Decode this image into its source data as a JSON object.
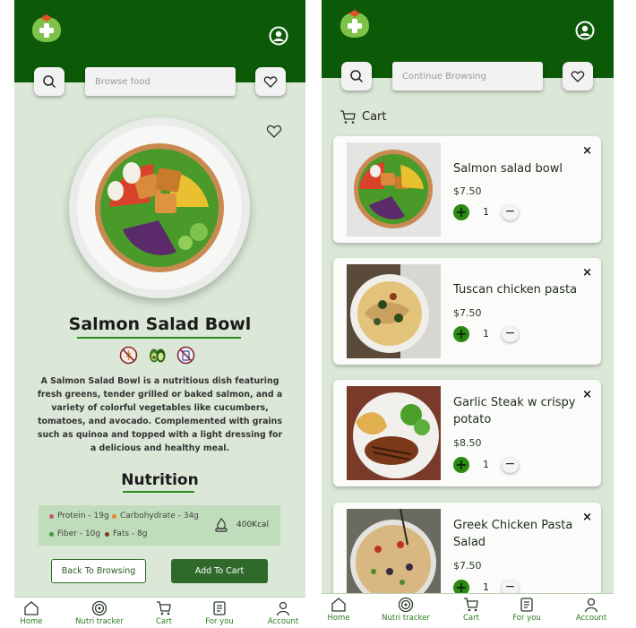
{
  "detail": {
    "search_placeholder": "Browse food",
    "title": "Salmon Salad Bowl",
    "description": "A Salmon Salad Bowl is a nutritious dish featuring fresh greens, tender grilled or baked salmon, and a variety of colorful vegetables like cucumbers, tomatoes, and avocado. Complemented with grains such as quinoa and topped with a light dressing for a delicious and healthy meal.",
    "diet_icons": [
      "no-gluten-icon",
      "avocado-icon",
      "no-dairy-icon"
    ],
    "nutrition_heading": "Nutrition",
    "nutrients": [
      {
        "label": "Protein - 19g",
        "color": "#c0567a"
      },
      {
        "label": "Carbohydrate - 34g",
        "color": "#e08a2a"
      },
      {
        "label": "Fiber - 10g",
        "color": "#3f9a3a"
      },
      {
        "label": "Fats - 8g",
        "color": "#7a3b1a"
      }
    ],
    "calories": "400Kcal",
    "back_button": "Back To Browsing",
    "add_button": "Add To Cart"
  },
  "cart_screen": {
    "search_placeholder": "Continue Browsing",
    "heading": "Cart",
    "items": [
      {
        "name": "Salmon salad bowl",
        "price": "$7.50",
        "qty": "1"
      },
      {
        "name": "Tuscan chicken pasta",
        "price": "$7.50",
        "qty": "1"
      },
      {
        "name": "Garlic Steak w crispy potato",
        "price": "$8.50",
        "qty": "1"
      },
      {
        "name": "Greek Chicken Pasta Salad",
        "price": "$7.50",
        "qty": "1"
      }
    ]
  },
  "nav": [
    "Home",
    "Nutri tracker",
    "Cart",
    "For you",
    "Account"
  ],
  "colors": {
    "header_green": "#0c5a07",
    "background": "#dbe8d8",
    "accent_green": "#2a8a12",
    "button_green": "#2f6a2a"
  }
}
